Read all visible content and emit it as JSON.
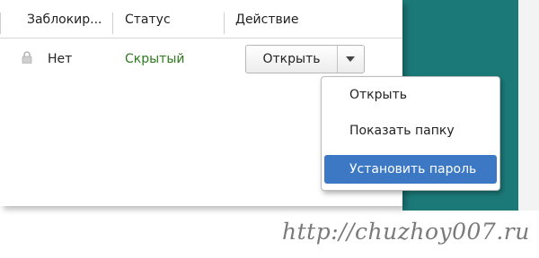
{
  "table": {
    "columns": [
      "Заблокир...",
      "Статус",
      "Действие"
    ],
    "rows": [
      {
        "blocked": "Нет",
        "status": "Скрытый",
        "action_button": "Открыть"
      }
    ]
  },
  "dropdown_menu": {
    "items": [
      "Открыть",
      "Показать папку",
      "Установить пароль"
    ],
    "highlighted_index": 2
  },
  "watermark": "http://chuzhoy007.ru",
  "colors": {
    "status_text": "#2c7a1c",
    "menu_highlight": "#3d78c4",
    "background_accent": "#1b7a78"
  },
  "icons": {
    "row_icon": "lock-icon",
    "split_arrow": "chevron-down-icon"
  }
}
